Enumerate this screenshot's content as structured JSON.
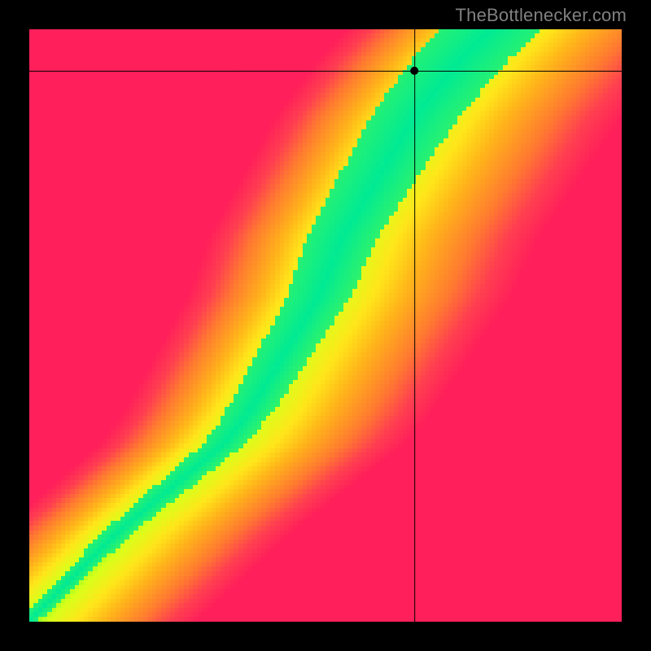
{
  "watermark": "TheBottlenecker.com",
  "chart_data": {
    "type": "heatmap",
    "title": "",
    "xlabel": "",
    "ylabel": "",
    "x_range": [
      0,
      1
    ],
    "y_range": [
      0,
      1
    ],
    "marker": {
      "x": 0.65,
      "y": 0.93
    },
    "crosshair": {
      "x": 0.65,
      "y": 0.93
    },
    "ridge_points": [
      {
        "y": 0.0,
        "x": 0.0
      },
      {
        "y": 0.05,
        "x": 0.05
      },
      {
        "y": 0.1,
        "x": 0.1
      },
      {
        "y": 0.15,
        "x": 0.15
      },
      {
        "y": 0.2,
        "x": 0.21
      },
      {
        "y": 0.25,
        "x": 0.27
      },
      {
        "y": 0.3,
        "x": 0.33
      },
      {
        "y": 0.35,
        "x": 0.37
      },
      {
        "y": 0.4,
        "x": 0.4
      },
      {
        "y": 0.45,
        "x": 0.43
      },
      {
        "y": 0.5,
        "x": 0.46
      },
      {
        "y": 0.55,
        "x": 0.49
      },
      {
        "y": 0.6,
        "x": 0.51
      },
      {
        "y": 0.65,
        "x": 0.53
      },
      {
        "y": 0.7,
        "x": 0.56
      },
      {
        "y": 0.75,
        "x": 0.59
      },
      {
        "y": 0.8,
        "x": 0.62
      },
      {
        "y": 0.85,
        "x": 0.65
      },
      {
        "y": 0.9,
        "x": 0.69
      },
      {
        "y": 0.95,
        "x": 0.73
      },
      {
        "y": 1.0,
        "x": 0.78
      }
    ],
    "color_stops": [
      {
        "t": 0.0,
        "color": "#00ea94"
      },
      {
        "t": 0.1,
        "color": "#7aff2a"
      },
      {
        "t": 0.2,
        "color": "#d8ff1a"
      },
      {
        "t": 0.35,
        "color": "#ffe61a"
      },
      {
        "t": 0.5,
        "color": "#ffb41a"
      },
      {
        "t": 0.7,
        "color": "#ff7a30"
      },
      {
        "t": 0.85,
        "color": "#ff3f50"
      },
      {
        "t": 1.0,
        "color": "#ff1f5a"
      }
    ],
    "pixel_resolution": 130
  }
}
